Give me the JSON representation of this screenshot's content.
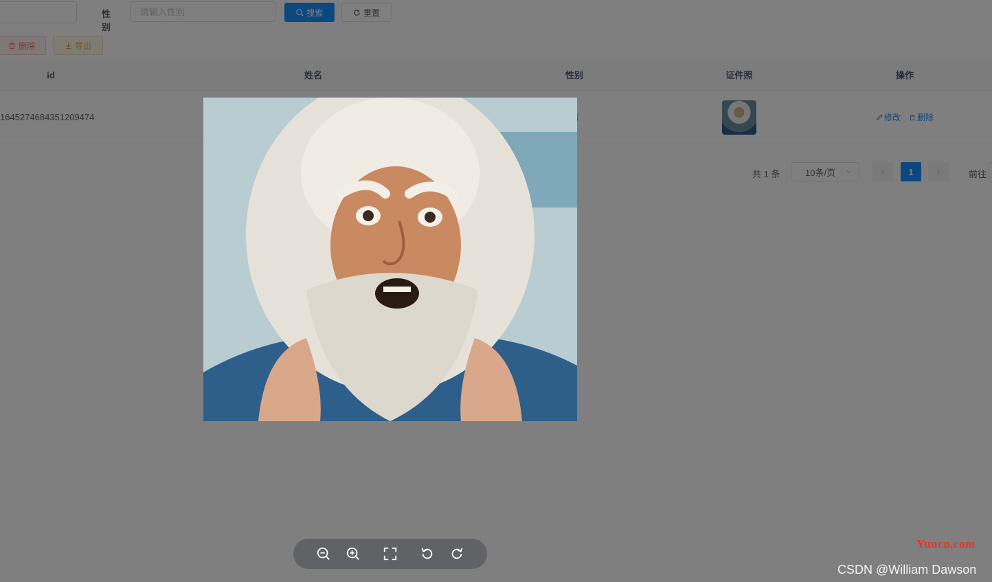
{
  "search": {
    "gender_label": "性别",
    "gender_placeholder": "请输入性别",
    "search_label": "搜索",
    "reset_label": "重置"
  },
  "toolbar": {
    "delete_label": "删除",
    "export_label": "导出"
  },
  "table": {
    "columns": [
      "id",
      "姓名",
      "性别",
      "证件照",
      "操作"
    ],
    "rows": [
      {
        "id": "1645274684351209474",
        "name": "",
        "gender": "男",
        "edit_label": "修改",
        "delete_label": "删除"
      }
    ]
  },
  "pagination": {
    "total_text": "共 1 条",
    "page_size": "10条/页",
    "current_page": "1",
    "goto_label": "前往"
  },
  "viewer": {
    "tools": [
      "zoom-out-icon",
      "zoom-in-icon",
      "fullscreen-icon",
      "rotate-left-icon",
      "rotate-right-icon"
    ]
  },
  "watermarks": {
    "site": "Yuucn.com",
    "author": "CSDN @William Dawson"
  },
  "colors": {
    "primary": "#1890ff",
    "danger": "#f56c6c",
    "warning": "#e6a23c"
  }
}
